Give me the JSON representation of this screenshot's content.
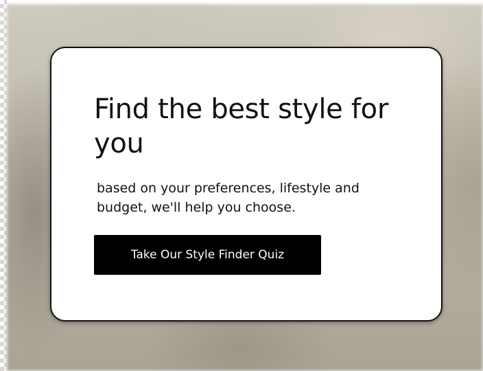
{
  "card": {
    "title": "Find the best style for you",
    "subtitle": "based on your preferences, lifestyle and budget, we'll help you choose.",
    "cta_label": "Take Our Style Finder Quiz"
  },
  "colors": {
    "card_background": "#ffffff",
    "card_border": "#111111",
    "text": "#111111",
    "button_background": "#000000",
    "button_text": "#ffffff"
  }
}
